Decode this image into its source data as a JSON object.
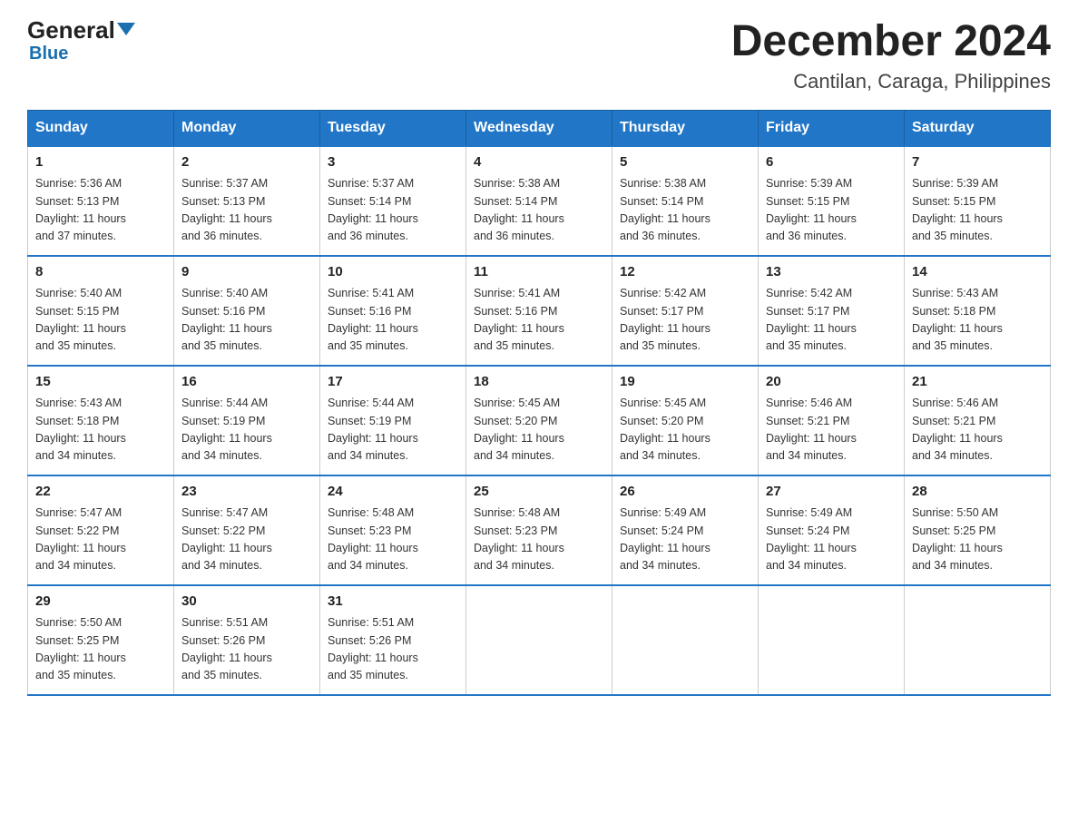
{
  "logo": {
    "general": "General",
    "triangle": "▲",
    "blue": "Blue"
  },
  "title": "December 2024",
  "subtitle": "Cantilan, Caraga, Philippines",
  "days_of_week": [
    "Sunday",
    "Monday",
    "Tuesday",
    "Wednesday",
    "Thursday",
    "Friday",
    "Saturday"
  ],
  "weeks": [
    [
      {
        "day": "1",
        "sunrise": "5:36 AM",
        "sunset": "5:13 PM",
        "daylight": "11 hours and 37 minutes."
      },
      {
        "day": "2",
        "sunrise": "5:37 AM",
        "sunset": "5:13 PM",
        "daylight": "11 hours and 36 minutes."
      },
      {
        "day": "3",
        "sunrise": "5:37 AM",
        "sunset": "5:14 PM",
        "daylight": "11 hours and 36 minutes."
      },
      {
        "day": "4",
        "sunrise": "5:38 AM",
        "sunset": "5:14 PM",
        "daylight": "11 hours and 36 minutes."
      },
      {
        "day": "5",
        "sunrise": "5:38 AM",
        "sunset": "5:14 PM",
        "daylight": "11 hours and 36 minutes."
      },
      {
        "day": "6",
        "sunrise": "5:39 AM",
        "sunset": "5:15 PM",
        "daylight": "11 hours and 36 minutes."
      },
      {
        "day": "7",
        "sunrise": "5:39 AM",
        "sunset": "5:15 PM",
        "daylight": "11 hours and 35 minutes."
      }
    ],
    [
      {
        "day": "8",
        "sunrise": "5:40 AM",
        "sunset": "5:15 PM",
        "daylight": "11 hours and 35 minutes."
      },
      {
        "day": "9",
        "sunrise": "5:40 AM",
        "sunset": "5:16 PM",
        "daylight": "11 hours and 35 minutes."
      },
      {
        "day": "10",
        "sunrise": "5:41 AM",
        "sunset": "5:16 PM",
        "daylight": "11 hours and 35 minutes."
      },
      {
        "day": "11",
        "sunrise": "5:41 AM",
        "sunset": "5:16 PM",
        "daylight": "11 hours and 35 minutes."
      },
      {
        "day": "12",
        "sunrise": "5:42 AM",
        "sunset": "5:17 PM",
        "daylight": "11 hours and 35 minutes."
      },
      {
        "day": "13",
        "sunrise": "5:42 AM",
        "sunset": "5:17 PM",
        "daylight": "11 hours and 35 minutes."
      },
      {
        "day": "14",
        "sunrise": "5:43 AM",
        "sunset": "5:18 PM",
        "daylight": "11 hours and 35 minutes."
      }
    ],
    [
      {
        "day": "15",
        "sunrise": "5:43 AM",
        "sunset": "5:18 PM",
        "daylight": "11 hours and 34 minutes."
      },
      {
        "day": "16",
        "sunrise": "5:44 AM",
        "sunset": "5:19 PM",
        "daylight": "11 hours and 34 minutes."
      },
      {
        "day": "17",
        "sunrise": "5:44 AM",
        "sunset": "5:19 PM",
        "daylight": "11 hours and 34 minutes."
      },
      {
        "day": "18",
        "sunrise": "5:45 AM",
        "sunset": "5:20 PM",
        "daylight": "11 hours and 34 minutes."
      },
      {
        "day": "19",
        "sunrise": "5:45 AM",
        "sunset": "5:20 PM",
        "daylight": "11 hours and 34 minutes."
      },
      {
        "day": "20",
        "sunrise": "5:46 AM",
        "sunset": "5:21 PM",
        "daylight": "11 hours and 34 minutes."
      },
      {
        "day": "21",
        "sunrise": "5:46 AM",
        "sunset": "5:21 PM",
        "daylight": "11 hours and 34 minutes."
      }
    ],
    [
      {
        "day": "22",
        "sunrise": "5:47 AM",
        "sunset": "5:22 PM",
        "daylight": "11 hours and 34 minutes."
      },
      {
        "day": "23",
        "sunrise": "5:47 AM",
        "sunset": "5:22 PM",
        "daylight": "11 hours and 34 minutes."
      },
      {
        "day": "24",
        "sunrise": "5:48 AM",
        "sunset": "5:23 PM",
        "daylight": "11 hours and 34 minutes."
      },
      {
        "day": "25",
        "sunrise": "5:48 AM",
        "sunset": "5:23 PM",
        "daylight": "11 hours and 34 minutes."
      },
      {
        "day": "26",
        "sunrise": "5:49 AM",
        "sunset": "5:24 PM",
        "daylight": "11 hours and 34 minutes."
      },
      {
        "day": "27",
        "sunrise": "5:49 AM",
        "sunset": "5:24 PM",
        "daylight": "11 hours and 34 minutes."
      },
      {
        "day": "28",
        "sunrise": "5:50 AM",
        "sunset": "5:25 PM",
        "daylight": "11 hours and 34 minutes."
      }
    ],
    [
      {
        "day": "29",
        "sunrise": "5:50 AM",
        "sunset": "5:25 PM",
        "daylight": "11 hours and 35 minutes."
      },
      {
        "day": "30",
        "sunrise": "5:51 AM",
        "sunset": "5:26 PM",
        "daylight": "11 hours and 35 minutes."
      },
      {
        "day": "31",
        "sunrise": "5:51 AM",
        "sunset": "5:26 PM",
        "daylight": "11 hours and 35 minutes."
      },
      null,
      null,
      null,
      null
    ]
  ],
  "labels": {
    "sunrise": "Sunrise:",
    "sunset": "Sunset:",
    "daylight": "Daylight:"
  }
}
